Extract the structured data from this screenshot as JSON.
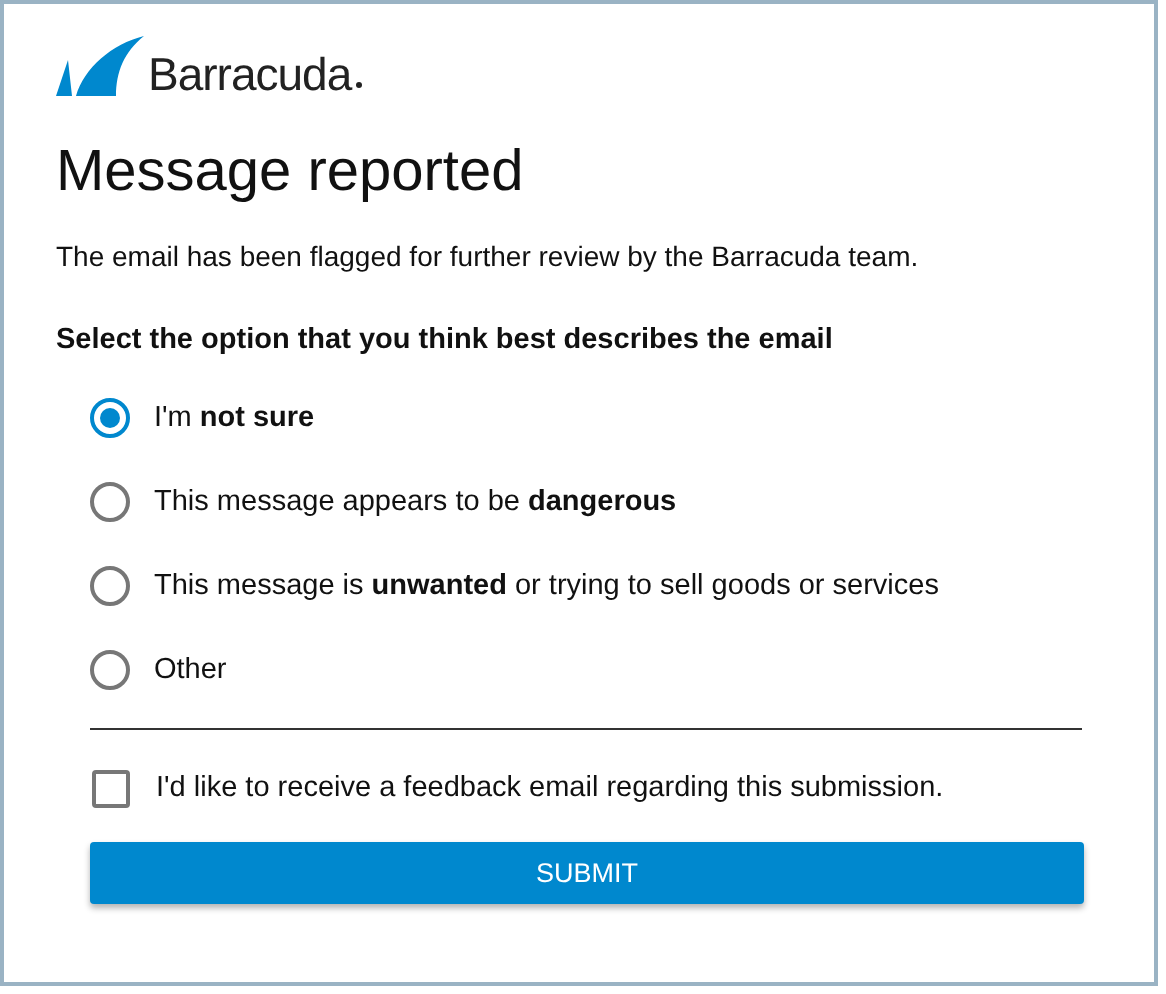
{
  "logo": {
    "text": "Barracuda"
  },
  "title": "Message reported",
  "message": "The email has been flagged for further review by the Barracuda team.",
  "question": "Select the option that you think best describes the email",
  "options": [
    {
      "label": "I'm **not sure**",
      "selected": true
    },
    {
      "label": "This message appears to be **dangerous**",
      "selected": false
    },
    {
      "label": "This message is **unwanted** or trying to sell goods or services",
      "selected": false
    },
    {
      "label": "Other",
      "selected": false
    }
  ],
  "feedback": {
    "label": "I'd like to receive a feedback email regarding this submission.",
    "checked": false
  },
  "submit": "SUBMIT"
}
